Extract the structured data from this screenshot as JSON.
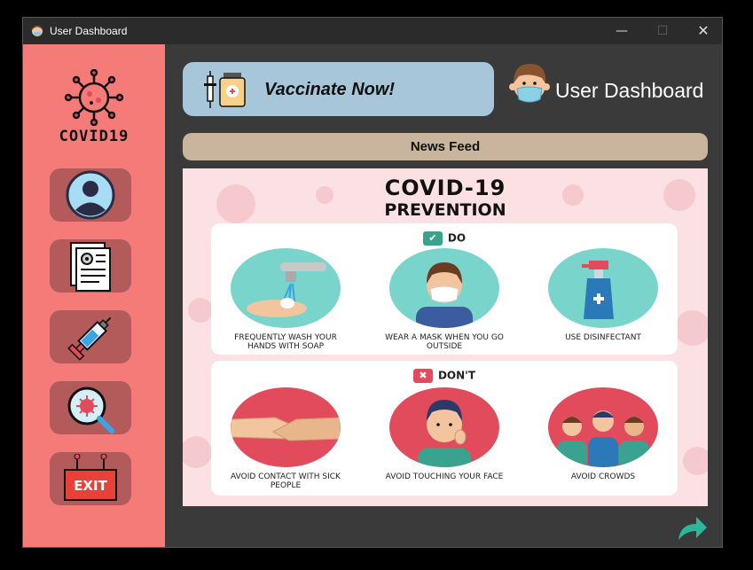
{
  "window": {
    "title": "User Dashboard",
    "controls": {
      "minimize": "—",
      "maximize": "☐",
      "close": "✕"
    }
  },
  "sidebar": {
    "logo_text": "COVID19",
    "buttons": [
      {
        "name": "profile",
        "icon": "user-profile-icon"
      },
      {
        "name": "documents",
        "icon": "document-gear-icon"
      },
      {
        "name": "vaccine",
        "icon": "syringe-icon"
      },
      {
        "name": "virus-search",
        "icon": "virus-magnifier-icon"
      },
      {
        "name": "exit",
        "icon": "exit-sign-icon",
        "label": "EXIT"
      }
    ]
  },
  "header": {
    "vaccinate_label": "Vaccinate Now!",
    "dashboard_title": "User Dashboard"
  },
  "news_feed": {
    "label": "News Feed",
    "poster": {
      "title_line1": "COVID-19",
      "title_line2": "PREVENTION",
      "do_label": "DO",
      "dont_label": "DON'T",
      "do_items": [
        "Frequently wash your hands with soap",
        "Wear a mask when you go outside",
        "Use disinfectant"
      ],
      "dont_items": [
        "Avoid contact with sick people",
        "Avoid touching your face",
        "Avoid crowds"
      ]
    }
  },
  "colors": {
    "sidebar": "#f47b78",
    "sidebar_button": "#b35a5a",
    "window_bg": "#3a3a3a",
    "vaccinate_banner": "#a7c6d9",
    "news_bar": "#c9b59d",
    "next_arrow": "#2bb89a"
  }
}
